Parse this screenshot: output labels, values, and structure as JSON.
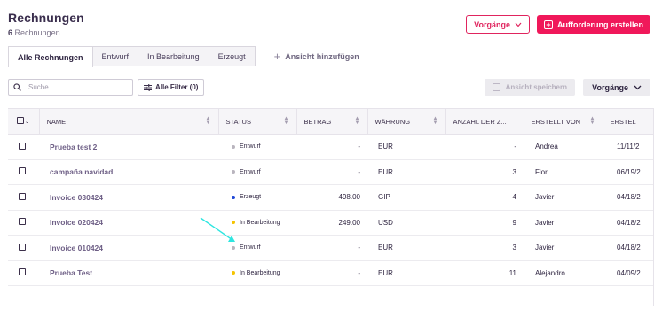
{
  "header": {
    "title": "Rechnungen",
    "count": "6",
    "count_label": "Rechnungen"
  },
  "actions": {
    "vorgaenge": "Vorgänge",
    "create": "Aufforderung erstellen"
  },
  "tabs": [
    {
      "label": "Alle Rechnungen",
      "active": true
    },
    {
      "label": "Entwurf"
    },
    {
      "label": "In Bearbeitung"
    },
    {
      "label": "Erzeugt"
    }
  ],
  "add_view": "Ansicht hinzufügen",
  "toolbar": {
    "search_placeholder": "Suche",
    "filter_label": "Alle Filter (0)",
    "save_view": "Ansicht speichern",
    "vorgaenge": "Vorgänge"
  },
  "columns": {
    "name": "NAME",
    "status": "STATUS",
    "betrag": "BETRAG",
    "waehrung": "WÄHRUNG",
    "anzahl": "ANZAHL DER Z...",
    "erstellt_von": "ERSTELLT VON",
    "erstellt": "ERSTEL"
  },
  "status_colors": {
    "Entwurf": "#b9b5be",
    "Erzeugt": "#1f47d6",
    "In Bearbeitung": "#f5c400"
  },
  "accent": "#f0185a",
  "rows": [
    {
      "name": "Prueba test 2",
      "status": "Entwurf",
      "betrag": "-",
      "waehrung": "EUR",
      "anzahl": "-",
      "von": "Andrea",
      "datum": "11/11/2"
    },
    {
      "name": "campaña navidad",
      "status": "Entwurf",
      "betrag": "-",
      "waehrung": "EUR",
      "anzahl": "3",
      "von": "Flor",
      "datum": "06/19/2"
    },
    {
      "name": "Invoice 030424",
      "status": "Erzeugt",
      "betrag": "498.00",
      "waehrung": "GIP",
      "anzahl": "4",
      "von": "Javier",
      "datum": "04/18/2"
    },
    {
      "name": "Invoice 020424",
      "status": "In Bearbeitung",
      "betrag": "249.00",
      "waehrung": "USD",
      "anzahl": "9",
      "von": "Javier",
      "datum": "04/18/2"
    },
    {
      "name": "Invoice 010424",
      "status": "Entwurf",
      "betrag": "-",
      "waehrung": "EUR",
      "anzahl": "3",
      "von": "Javier",
      "datum": "04/18/2"
    },
    {
      "name": "Prueba Test",
      "status": "In Bearbeitung",
      "betrag": "-",
      "waehrung": "EUR",
      "anzahl": "11",
      "von": "Alejandro",
      "datum": "04/09/2"
    }
  ]
}
